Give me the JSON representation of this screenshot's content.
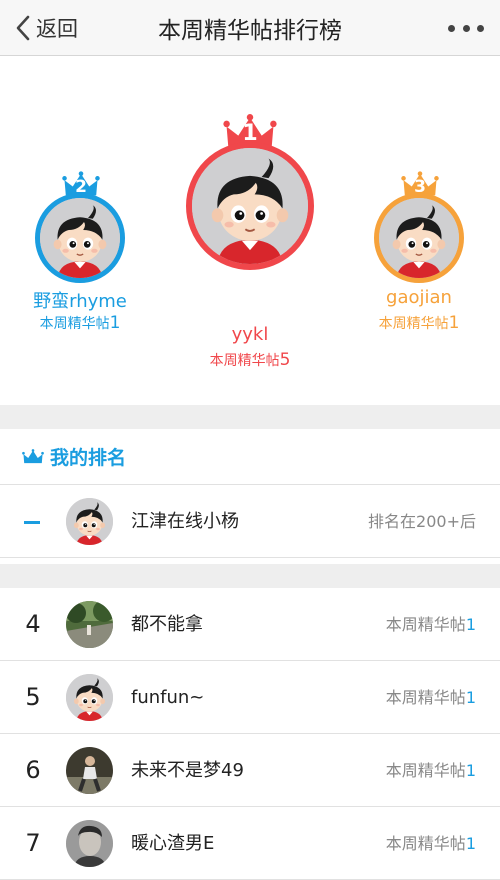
{
  "nav": {
    "back_label": "返回",
    "title": "本周精华帖排行榜"
  },
  "podium": [
    {
      "rank": "1",
      "name": "yykl",
      "count_label": "本周精华帖",
      "count": "5",
      "color": "#f0474b"
    },
    {
      "rank": "2",
      "name": "野蛮rhyme",
      "count_label": "本周精华帖",
      "count": "1",
      "color": "#1a9de0"
    },
    {
      "rank": "3",
      "name": "gaojian",
      "count_label": "本周精华帖",
      "count": "1",
      "color": "#f6a23b"
    }
  ],
  "my_rank": {
    "header": "我的排名",
    "name": "江津在线小杨",
    "status": "排名在200+后"
  },
  "list": [
    {
      "rank": "4",
      "name": "都不能拿",
      "count_label": "本周精华帖",
      "count": "1",
      "avatar": "park-photo"
    },
    {
      "rank": "5",
      "name": "funfun~",
      "count_label": "本周精华帖",
      "count": "1",
      "avatar": "cartoon-boy"
    },
    {
      "rank": "6",
      "name": "未来不是梦49",
      "count_label": "本周精华帖",
      "count": "1",
      "avatar": "runner-photo"
    },
    {
      "rank": "7",
      "name": "暖心渣男E",
      "count_label": "本周精华帖",
      "count": "1",
      "avatar": "portrait-photo"
    }
  ],
  "colors": {
    "accent": "#1a9de0",
    "gold": "#f0474b",
    "silver": "#1a9de0",
    "bronze": "#f6a23b"
  }
}
